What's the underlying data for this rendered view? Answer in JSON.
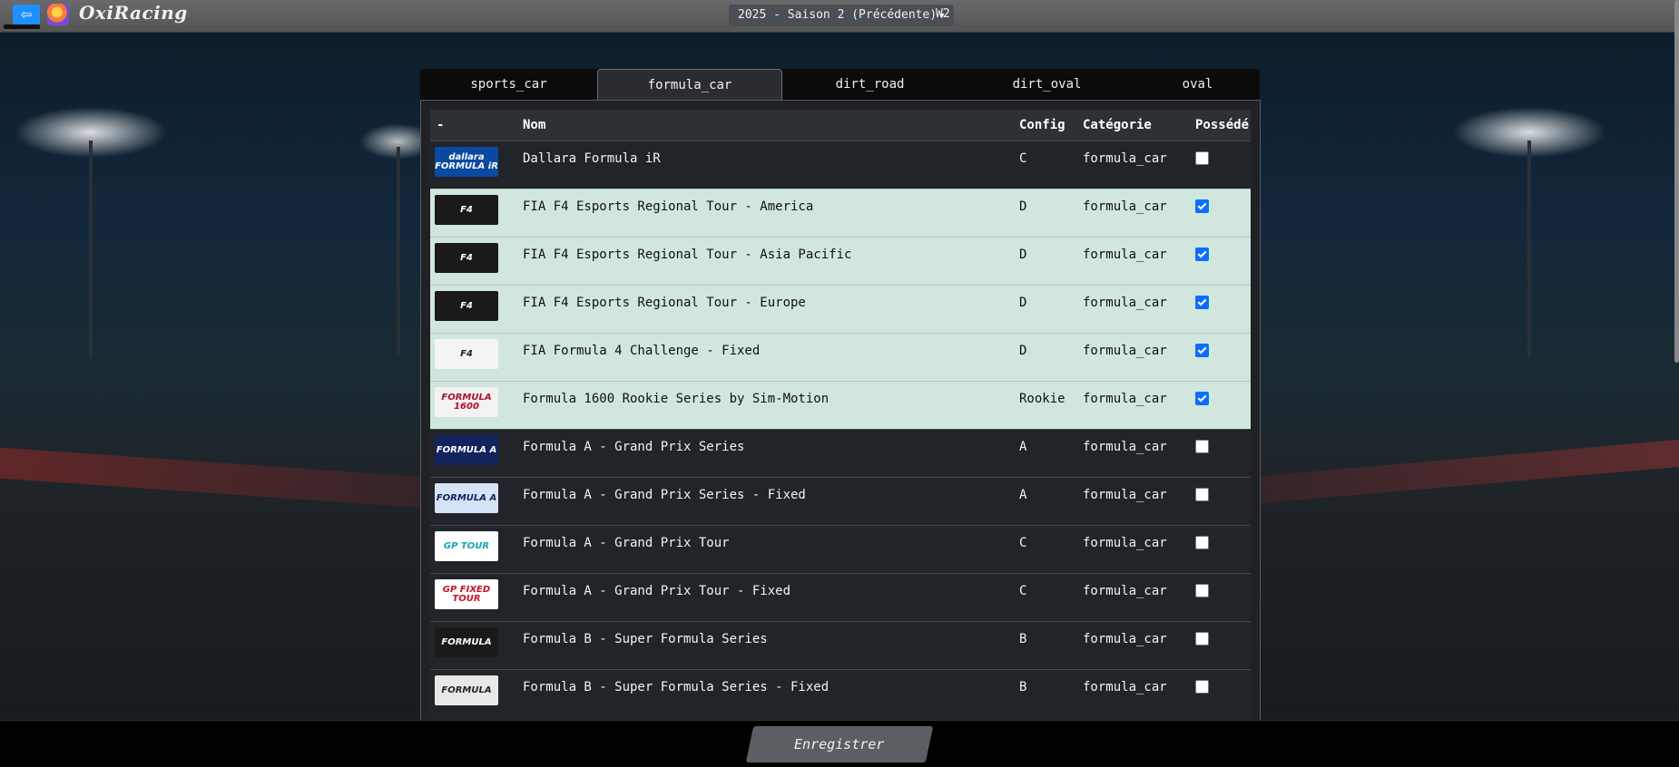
{
  "app": {
    "title": "OxiRacing"
  },
  "header": {
    "season": "2025 - Saison 2 (Précédente)",
    "week": "W2"
  },
  "tabs": [
    "sports_car",
    "formula_car",
    "dirt_road",
    "dirt_oval",
    "oval"
  ],
  "active_tab": "formula_car",
  "table": {
    "headers": [
      "-",
      "Nom",
      "Config",
      "Catégorie",
      "Possédé"
    ],
    "rows": [
      {
        "name": "Dallara Formula iR",
        "config": "C",
        "category": "formula_car",
        "owned": false,
        "logo": {
          "text": "dallara FORMULA iR",
          "bg": "#0a4aa0",
          "fg": "#ffffff"
        }
      },
      {
        "name": "FIA F4 Esports Regional Tour - America",
        "config": "D",
        "category": "formula_car",
        "owned": true,
        "logo": {
          "text": "F4",
          "bg": "#1a1a1a",
          "fg": "#ffffff"
        }
      },
      {
        "name": "FIA F4 Esports Regional Tour - Asia Pacific",
        "config": "D",
        "category": "formula_car",
        "owned": true,
        "logo": {
          "text": "F4",
          "bg": "#1a1a1a",
          "fg": "#ffffff"
        }
      },
      {
        "name": "FIA F4 Esports Regional Tour - Europe",
        "config": "D",
        "category": "formula_car",
        "owned": true,
        "logo": {
          "text": "F4",
          "bg": "#1a1a1a",
          "fg": "#ffffff"
        }
      },
      {
        "name": "FIA Formula 4 Challenge - Fixed",
        "config": "D",
        "category": "formula_car",
        "owned": true,
        "logo": {
          "text": "F4",
          "bg": "#f4f4f4",
          "fg": "#222222"
        }
      },
      {
        "name": "Formula 1600 Rookie Series by Sim-Motion",
        "config": "Rookie",
        "category": "formula_car",
        "owned": true,
        "logo": {
          "text": "FORMULA 1600",
          "bg": "#f2f2f2",
          "fg": "#b0102a"
        }
      },
      {
        "name": "Formula A - Grand Prix Series",
        "config": "A",
        "category": "formula_car",
        "owned": false,
        "logo": {
          "text": "FORMULA A",
          "bg": "#12235e",
          "fg": "#ffffff"
        }
      },
      {
        "name": "Formula A - Grand Prix Series - Fixed",
        "config": "A",
        "category": "formula_car",
        "owned": false,
        "logo": {
          "text": "FORMULA A",
          "bg": "#d6e2f5",
          "fg": "#12235e"
        }
      },
      {
        "name": "Formula A - Grand Prix Tour",
        "config": "C",
        "category": "formula_car",
        "owned": false,
        "logo": {
          "text": "GP TOUR",
          "bg": "#ffffff",
          "fg": "#12a6b5"
        }
      },
      {
        "name": "Formula A - Grand Prix Tour - Fixed",
        "config": "C",
        "category": "formula_car",
        "owned": false,
        "logo": {
          "text": "GP FIXED TOUR",
          "bg": "#ffffff",
          "fg": "#c4162b"
        }
      },
      {
        "name": "Formula B - Super Formula Series",
        "config": "B",
        "category": "formula_car",
        "owned": false,
        "logo": {
          "text": "FORMULA",
          "bg": "#1a1a1a",
          "fg": "#ffffff"
        }
      },
      {
        "name": "Formula B - Super Formula Series - Fixed",
        "config": "B",
        "category": "formula_car",
        "owned": false,
        "logo": {
          "text": "FORMULA",
          "bg": "#e8e8e8",
          "fg": "#222222"
        }
      }
    ]
  },
  "footer": {
    "save_label": "Enregistrer"
  },
  "colors": {
    "owned_row": "#d1e7dd",
    "checkbox_on": "#0d6efd",
    "back_button": "#1e90ff"
  },
  "icons": {
    "back": "back-arrow-icon",
    "logo": "oxiracing-logo-icon",
    "dropdown": "caret-down-icon"
  }
}
